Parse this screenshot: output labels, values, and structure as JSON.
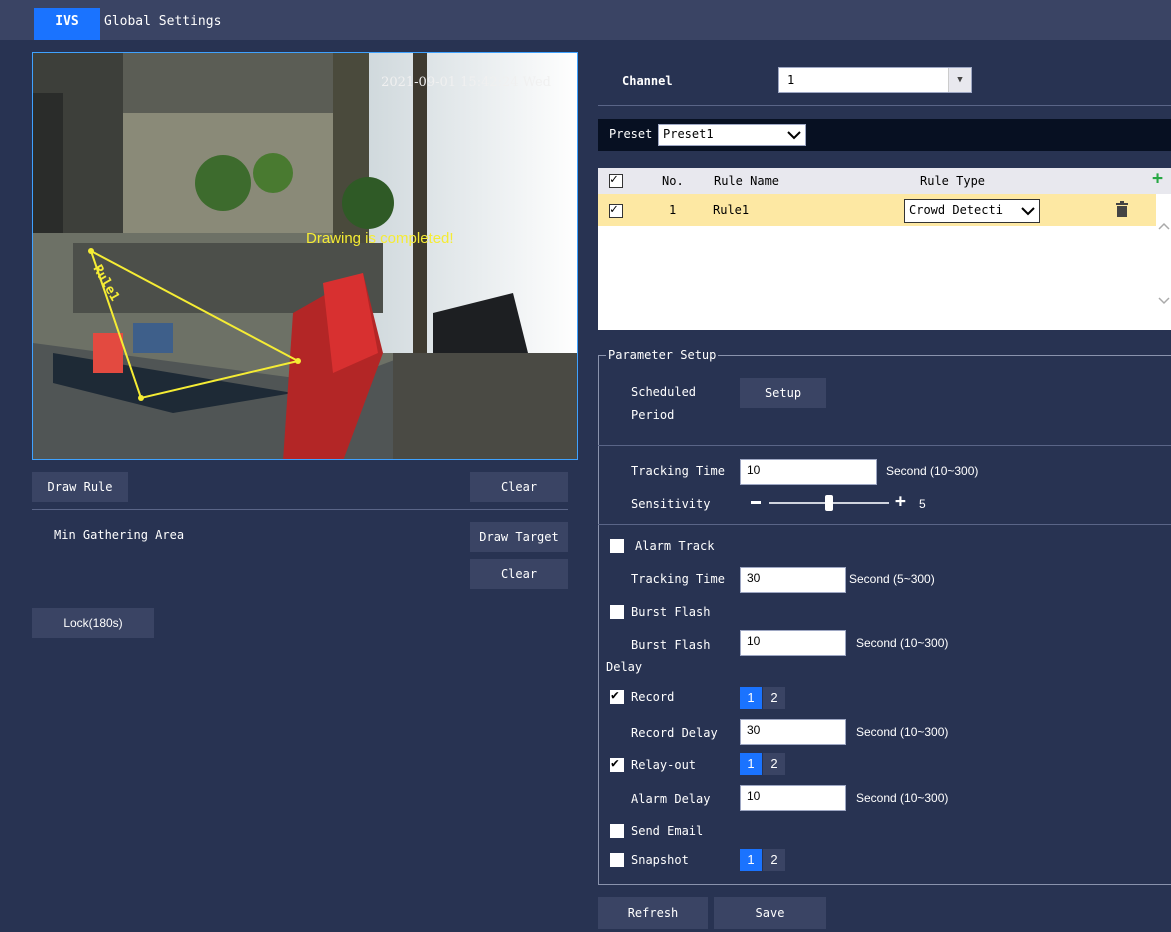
{
  "tabs": {
    "ivs": "IVS",
    "global": "Global Settings"
  },
  "video": {
    "timestamp": "2021-09-01 15:42:24 Wed",
    "status_msg": "Drawing is completed!",
    "rule_overlay": "Rule1"
  },
  "left": {
    "draw_rule": "Draw Rule",
    "clear": "Clear",
    "min_gathering_area": "Min Gathering Area",
    "draw_target": "Draw Target",
    "clear2": "Clear",
    "lock": "Lock(180s)"
  },
  "channel": {
    "label": "Channel",
    "value": "1"
  },
  "preset": {
    "label": "Preset",
    "value": "Preset1"
  },
  "rules_table": {
    "headers": {
      "no": "No.",
      "name": "Rule Name",
      "type": "Rule Type"
    },
    "rows": [
      {
        "no": "1",
        "name": "Rule1",
        "type": "Crowd Detecti"
      }
    ]
  },
  "params": {
    "legend": "Parameter Setup",
    "scheduled_period_line1": "Scheduled",
    "scheduled_period_line2": "Period",
    "setup": "Setup",
    "tracking_time_label": "Tracking Time",
    "tracking_time_value": "10",
    "tracking_time_unit": "Second (10~300)",
    "sensitivity_label": "Sensitivity",
    "sensitivity_value": "5",
    "sensitivity_level": 0.5,
    "alarm_track": "Alarm Track",
    "alarm_tracking_time_label": "Tracking Time",
    "alarm_tracking_time_value": "30",
    "alarm_tracking_time_unit": "Second (5~300)",
    "burst_flash": "Burst Flash",
    "burst_flash_delay_line1": "Burst Flash",
    "burst_flash_delay_line2": "Delay",
    "burst_flash_delay_value": "10",
    "burst_flash_delay_unit": "Second (10~300)",
    "record": "Record",
    "record_delay_label": "Record Delay",
    "record_delay_value": "30",
    "record_delay_unit": "Second (10~300)",
    "relay_out": "Relay-out",
    "alarm_delay_label": "Alarm Delay",
    "alarm_delay_value": "10",
    "alarm_delay_unit": "Second (10~300)",
    "send_email": "Send Email",
    "snapshot": "Snapshot",
    "ch1": "1",
    "ch2": "2"
  },
  "footer": {
    "refresh": "Refresh",
    "save": "Save"
  },
  "colors": {
    "background": "#283352",
    "accent": "#1a73ff",
    "button": "#3a4464",
    "overlay": "#f5ec34"
  }
}
